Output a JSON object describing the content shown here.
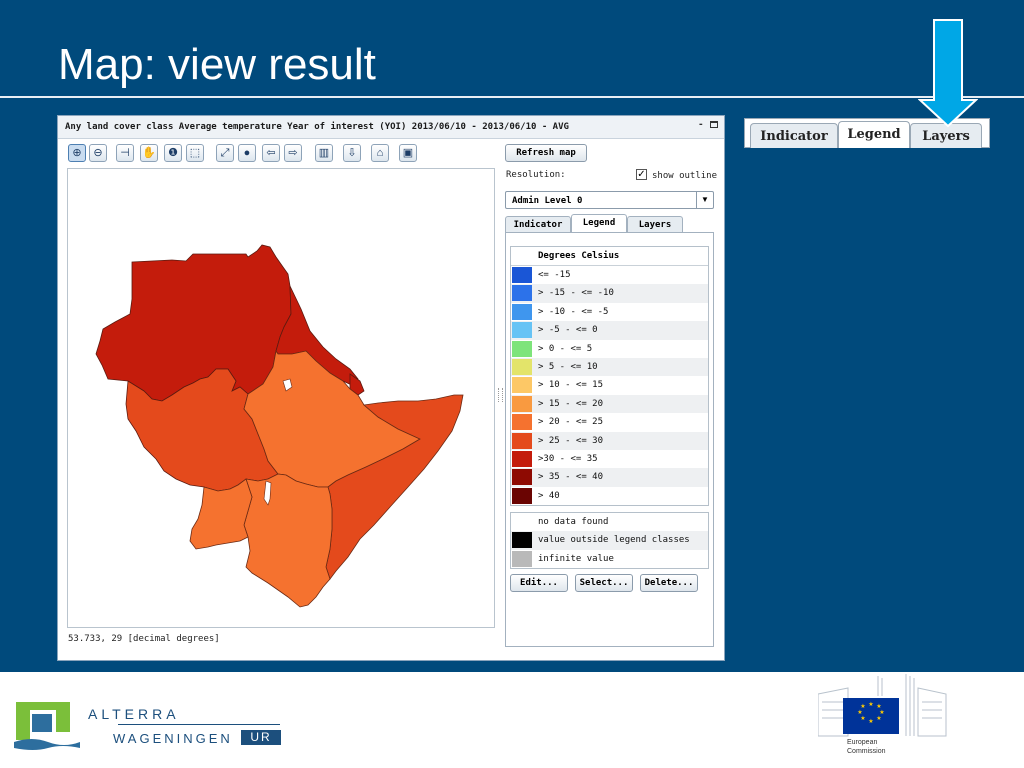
{
  "slide": {
    "title": "Map: view result"
  },
  "window": {
    "title": "Any land cover class Average temperature Year of interest (YOI) 2013/06/10 - 2013/06/10 - AVG",
    "minimize": "-",
    "coordinates": "53.733, 29 [decimal degrees]"
  },
  "toolbar": {
    "icons": [
      "zoom-in-icon",
      "zoom-out-icon",
      "measure-icon",
      "pan-hand-icon",
      "info-icon",
      "select-feature-icon",
      "zoom-extent-icon",
      "globe-icon",
      "back-arrow-icon",
      "forward-arrow-icon",
      "chart-icon",
      "download-icon",
      "home-icon",
      "save-icon"
    ],
    "glyphs": [
      "⊕",
      "⊖",
      "⊣",
      "✋",
      "❶",
      "⬚",
      "⤢",
      "●",
      "⇦",
      "⇨",
      "▥",
      "⇩",
      "⌂",
      "▣"
    ]
  },
  "panel": {
    "refresh_label": "Refresh map",
    "resolution_label": "Resolution:",
    "show_outline_label": "show outline",
    "show_outline_checked": "✓",
    "admin_level": "Admin Level 0",
    "select_arrow": "▼",
    "tabs": [
      {
        "label": "Indicator"
      },
      {
        "label": "Legend"
      },
      {
        "label": "Layers"
      }
    ],
    "selected_tab": "Legend",
    "legend_header": "Degrees Celsius",
    "legend": [
      {
        "label": "<= -15",
        "color": "#1a56d6"
      },
      {
        "label": "> -15 - <= -10",
        "color": "#2c72ea"
      },
      {
        "label": "> -10 - <= -5",
        "color": "#3f96ee"
      },
      {
        "label": "> -5 - <= 0",
        "color": "#66c3f5"
      },
      {
        "label": "> 0 - <= 5",
        "color": "#7ee47b"
      },
      {
        "label": "> 5 - <= 10",
        "color": "#e3e46a"
      },
      {
        "label": "> 10 - <= 15",
        "color": "#fdc866"
      },
      {
        "label": "> 15 - <= 20",
        "color": "#f99a40"
      },
      {
        "label": "> 20 - <= 25",
        "color": "#f5722f"
      },
      {
        "label": "> 25 - <= 30",
        "color": "#e44a1c"
      },
      {
        "label": ">30 - <= 35",
        "color": "#c41c0c"
      },
      {
        "label": "> 35 - <= 40",
        "color": "#8e0a02"
      },
      {
        "label": "> 40",
        "color": "#6a0402"
      }
    ],
    "special_legend": [
      {
        "label": "no data found",
        "color": "#ffffff"
      },
      {
        "label": "value outside legend classes",
        "color": "#000000"
      },
      {
        "label": "infinite value",
        "color": "#b9b9b9"
      }
    ],
    "buttons": {
      "edit": "Edit...",
      "select": "Select...",
      "delete": "Delete..."
    }
  },
  "callout": {
    "tabs": [
      {
        "label": "Indicator"
      },
      {
        "label": "Legend"
      },
      {
        "label": "Layers"
      }
    ],
    "arrow_color": "#00a7e6"
  },
  "map": {
    "region_colors": {
      "sudan": "#c41c0c",
      "eritrea": "#c41c0c",
      "south_sudan": "#e44a1c",
      "ethiopia": "#f5722f",
      "somalia": "#e44a1c",
      "kenya": "#f5722f",
      "uganda": "#f5722f",
      "djibouti": "#c41c0c"
    }
  },
  "footer": {
    "alterra": "ALTERRA",
    "wageningen": "WAGENINGEN",
    "ur": "UR",
    "ec_line1": "European",
    "ec_line2": "Commission"
  }
}
